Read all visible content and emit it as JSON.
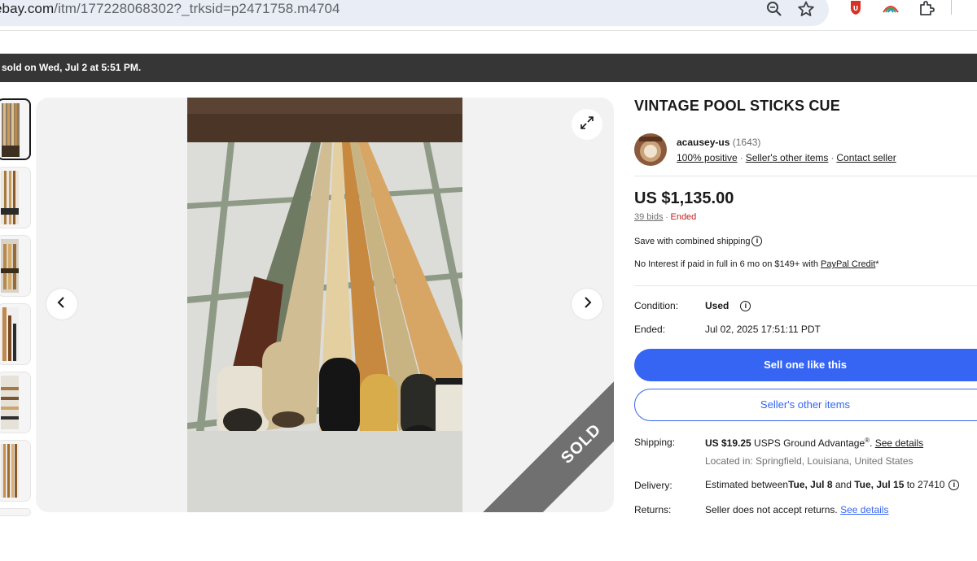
{
  "browser": {
    "url_host": "ebay.com",
    "url_path": "/itm/177228068302?_trksid=p2471758.m4704",
    "icons": [
      "site-info-icon",
      "zoom-icon",
      "bookmark-star-icon",
      "extension-shield-icon",
      "extension-rainbow-icon",
      "extensions-puzzle-icon"
    ]
  },
  "banner": {
    "text": "sold on Wed, Jul 2 at 5:51 PM."
  },
  "gallery": {
    "thumbnail_count": 6,
    "ribbon": "SOLD",
    "icons": [
      "expand-icon",
      "chevron-left-icon",
      "chevron-right-icon"
    ]
  },
  "listing": {
    "title": "VINTAGE POOL STICKS CUE",
    "seller": {
      "name": "acausey-us",
      "feedback_count": "(1643)",
      "positive": "100% positive",
      "other_items": "Seller's other items",
      "contact": "Contact seller"
    },
    "price": "US $1,135.00",
    "bids": "39 bids",
    "status": "Ended",
    "combined_shipping": "Save with combined shipping",
    "paypal": {
      "prefix": "No Interest if paid in full in 6 mo on $149+ with ",
      "link": "PayPal Credit",
      "suffix": "*"
    },
    "condition": {
      "label": "Condition:",
      "value": "Used"
    },
    "ended": {
      "label": "Ended:",
      "value": "Jul 02, 2025 17:51:11 PDT"
    },
    "buttons": {
      "sell_one": "Sell one like this",
      "seller_other": "Seller's other items"
    },
    "shipping": {
      "label": "Shipping:",
      "price": "US $19.25",
      "service": " USPS Ground Advantage",
      "reg": "®",
      "period": ". ",
      "details": "See details",
      "location": "Located in: Springfield, Louisiana, United States"
    },
    "delivery": {
      "label": "Delivery:",
      "prefix": "Estimated between ",
      "start": "Tue, Jul 8",
      "and": " and ",
      "end": "Tue, Jul 15",
      "suffix": " to 27410"
    },
    "returns": {
      "label": "Returns:",
      "text": "Seller does not accept returns. ",
      "details": "See details"
    }
  },
  "colors": {
    "primary_blue": "#3665f3",
    "ended_red": "#c41e1e",
    "banner_dark": "#363636",
    "ribbon_gray": "#707070"
  }
}
